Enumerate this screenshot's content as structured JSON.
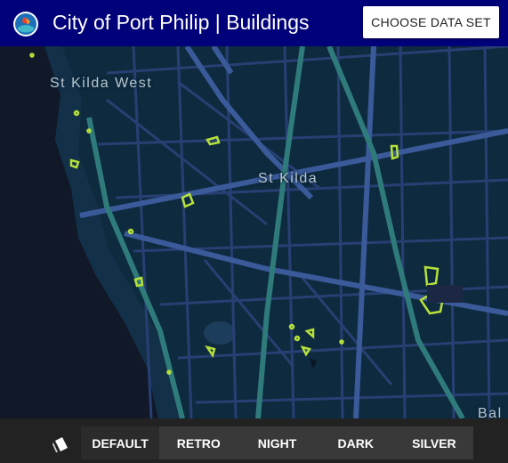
{
  "app": {
    "title": "City of Port Philip | Buildings",
    "choose_button": "CHOOSE DATA SET"
  },
  "map": {
    "labels": {
      "st_kilda_west": "St Kilda West",
      "st_kilda": "St Kilda",
      "balaclava_partial": "Bal"
    },
    "colors": {
      "water": "#111827",
      "land": "#0e2a3e",
      "road": "#2f4b86",
      "highway": "#2f7a7a",
      "buildings": "#b6e13a"
    }
  },
  "style_bar": {
    "icon": "map-style-icon",
    "buttons": [
      "DEFAULT",
      "RETRO",
      "NIGHT",
      "DARK",
      "SILVER"
    ],
    "selected": "DEFAULT"
  }
}
